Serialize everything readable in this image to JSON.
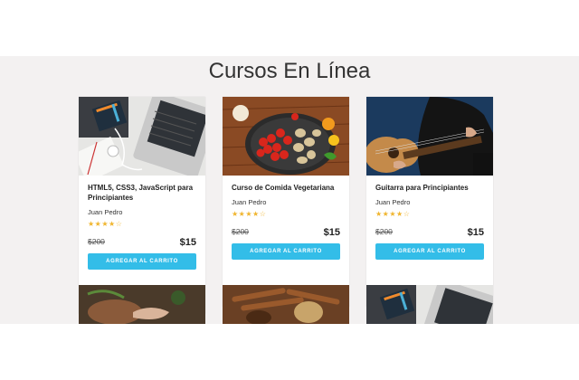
{
  "section": {
    "title": "Cursos En Línea"
  },
  "courses": [
    {
      "title": "HTML5, CSS3, JavaScript para Principiantes",
      "author": "Juan Pedro",
      "rating": "★★★★☆",
      "old_price": "$200",
      "price": "$15",
      "button": "AGREGAR AL CARRITO",
      "image": "laptop-notebook-image"
    },
    {
      "title": "Curso de Comida Vegetariana",
      "author": "Juan Pedro",
      "rating": "★★★★☆",
      "old_price": "$200",
      "price": "$15",
      "button": "AGREGAR AL CARRITO",
      "image": "vegetables-pan-image"
    },
    {
      "title": "Guitarra para Principiantes",
      "author": "Juan Pedro",
      "rating": "★★★★☆",
      "old_price": "$200",
      "price": "$15",
      "button": "AGREGAR AL CARRITO",
      "image": "guitar-player-image"
    }
  ],
  "bottom_row_images": [
    "hands-pottery-image",
    "cinnamon-spices-image",
    "laptop-notebook-image"
  ],
  "colors": {
    "button": "#33bde8",
    "stars": "#f0b52e",
    "band": "#f3f1f1"
  }
}
